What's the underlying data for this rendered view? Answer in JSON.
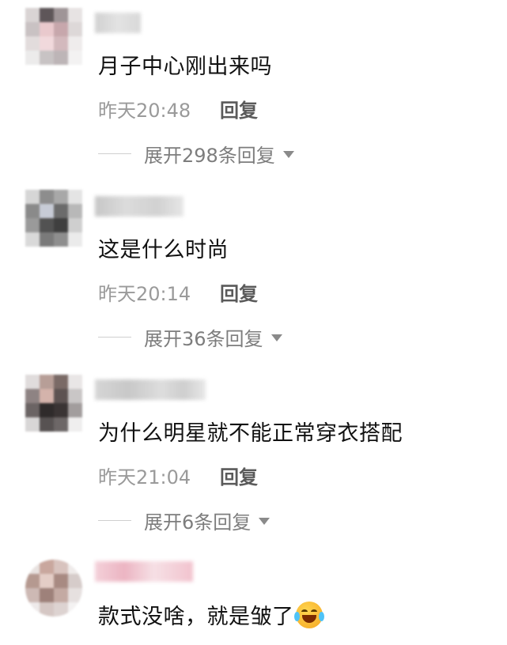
{
  "comments": [
    {
      "text": "月子中心刚出来吗",
      "time": "昨天20:48",
      "reply_label": "回复",
      "expand_label": "展开298条回复"
    },
    {
      "text": "这是什么时尚",
      "time": "昨天20:14",
      "reply_label": "回复",
      "expand_label": "展开36条回复"
    },
    {
      "text": "为什么明星就不能正常穿衣搭配",
      "time": "昨天21:04",
      "reply_label": "回复",
      "expand_label": "展开6条回复"
    },
    {
      "text": "款式没啥，就是皱了",
      "emoji": "rofl-emoji"
    }
  ],
  "colors": {
    "text": "#111111",
    "meta": "#9a9a9a",
    "reply": "#5a5a5a",
    "expand": "#7d7d7d"
  }
}
